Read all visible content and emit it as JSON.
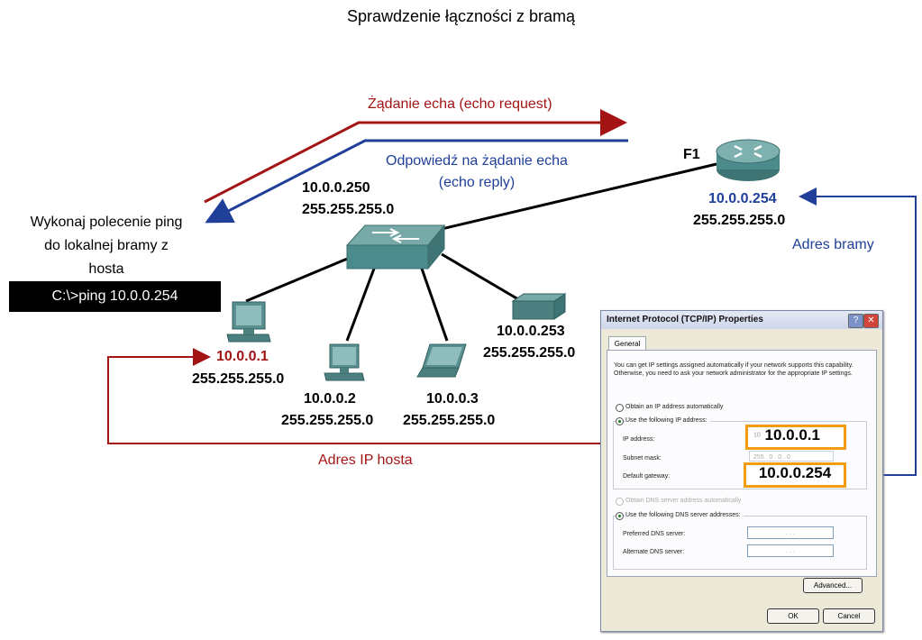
{
  "title": "Sprawdzenie łączności z bramą",
  "echo_request": "Żądanie echa (echo request)",
  "echo_reply_line1": "Odpowiedź na żądanie echa",
  "echo_reply_line2": "(echo reply)",
  "instruction": [
    "Wykonaj polecenie ping",
    "do lokalnej bramy z",
    "hosta"
  ],
  "command": "C:\\>ping 10.0.0.254",
  "switch": {
    "ip": "10.0.0.250",
    "mask": "255.255.255.0"
  },
  "router": {
    "interface": "F1",
    "ip": "10.0.0.254",
    "mask": "255.255.255.0"
  },
  "gateway_label": "Adres bramy",
  "host_ip_label": "Adres IP hosta",
  "hosts": [
    {
      "ip": "10.0.0.1",
      "mask": "255.255.255.0",
      "icon": "desktop-pc-icon"
    },
    {
      "ip": "10.0.0.2",
      "mask": "255.255.255.0",
      "icon": "desktop-pc-icon"
    },
    {
      "ip": "10.0.0.3",
      "mask": "255.255.255.0",
      "icon": "laptop-icon"
    },
    {
      "ip": "10.0.0.253",
      "mask": "255.255.255.0",
      "icon": "printer-icon"
    }
  ],
  "colors": {
    "request": "#a31515",
    "reply": "#1f3f99",
    "highlight": "#f39c12",
    "device": "#4c8b8b"
  },
  "dialog": {
    "title": "Internet Protocol (TCP/IP) Properties",
    "tab": "General",
    "intro": "You can get IP settings assigned automatically if your network supports this capability. Otherwise, you need to ask your network administrator for the appropriate IP settings.",
    "obtain_auto": "Obtain an IP address automatically",
    "use_following": "Use the following IP address:",
    "ip_label": "IP address:",
    "ip_value": "10.0.0.1",
    "ip_prefix": "10",
    "subnet_label": "Subnet mask:",
    "subnet_value": "255 . 0 . 0 . 0",
    "gateway_label": "Default gateway:",
    "gateway_value": "10.0.0.254",
    "dns_auto": "Obtain DNS server address automatically",
    "dns_use": "Use the following DNS server addresses:",
    "preferred_dns": "Preferred DNS server:",
    "alternate_dns": "Alternate DNS server:",
    "dns_placeholder": ".   .   .",
    "advanced": "Advanced...",
    "ok": "OK",
    "cancel": "Cancel",
    "help_glyph": "?",
    "close_glyph": "✕"
  }
}
